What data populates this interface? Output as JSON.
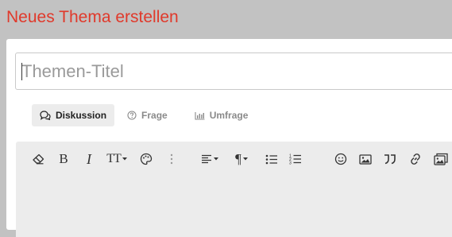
{
  "page": {
    "title": "Neues Thema erstellen"
  },
  "title_input": {
    "placeholder": "Themen-Titel",
    "value": ""
  },
  "tabs": [
    {
      "label": "Diskussion",
      "icon": "comments-icon",
      "active": true
    },
    {
      "label": "Frage",
      "icon": "question-circle-icon",
      "active": false
    },
    {
      "label": "Umfrage",
      "icon": "bar-chart-icon",
      "active": false
    }
  ],
  "toolbar": {
    "items": [
      {
        "name": "clear-formatting",
        "icon": "eraser-icon"
      },
      {
        "name": "bold",
        "glyph": "B"
      },
      {
        "name": "italic",
        "glyph": "I"
      },
      {
        "name": "text-size",
        "glyph": "TT"
      },
      {
        "name": "text-color",
        "icon": "palette-icon"
      },
      {
        "name": "more",
        "icon": "more-vertical-icon"
      },
      {
        "name": "align",
        "icon": "align-left-icon"
      },
      {
        "name": "paragraph-format",
        "glyph": "¶"
      },
      {
        "name": "unordered-list",
        "icon": "list-ul-icon"
      },
      {
        "name": "ordered-list",
        "icon": "list-ol-icon"
      },
      {
        "name": "emoticons",
        "icon": "smile-icon"
      },
      {
        "name": "insert-image",
        "icon": "image-icon"
      },
      {
        "name": "quote",
        "icon": "quote-icon"
      },
      {
        "name": "insert-link",
        "icon": "link-icon"
      },
      {
        "name": "gallery",
        "icon": "images-icon"
      }
    ]
  },
  "colors": {
    "title": "#e0392b",
    "background": "#c2c2c2",
    "toolbar": "#ececec"
  }
}
